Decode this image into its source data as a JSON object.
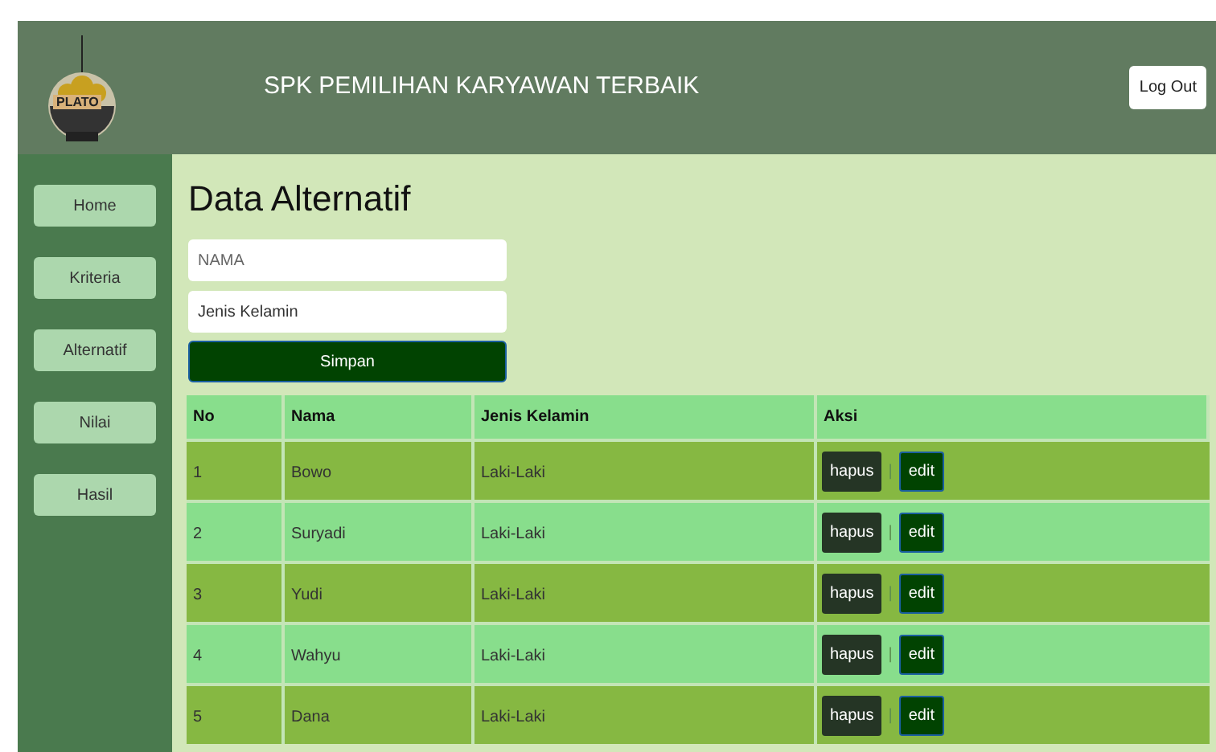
{
  "header": {
    "logo_text": "PLATO",
    "title": "SPK PEMILIHAN KARYAWAN TERBAIK",
    "logout": "Log Out"
  },
  "sidebar": {
    "items": [
      {
        "label": "Home"
      },
      {
        "label": "Kriteria"
      },
      {
        "label": "Alternatif"
      },
      {
        "label": "Nilai"
      },
      {
        "label": "Hasil"
      }
    ]
  },
  "page_title": "Data Alternatif",
  "form": {
    "name_field": {
      "placeholder": "NAMA"
    },
    "gender_field": {
      "placeholder": "Jenis Kelamin"
    },
    "submit": "Simpan"
  },
  "table": {
    "columns": [
      "No",
      "Nama",
      "Jenis Kelamin",
      "Aksi"
    ],
    "rows": [
      {
        "no": "1",
        "nama": "Bowo",
        "jenis_kelamin": "Laki-Laki",
        "delete": "hapus",
        "divider": "|",
        "edit": "edit"
      },
      {
        "no": "2",
        "nama": "Suryadi",
        "jenis_kelamin": "Laki-Laki",
        "delete": "hapus",
        "divider": "|",
        "edit": "edit"
      },
      {
        "no": "3",
        "nama": "Yudi",
        "jenis_kelamin": "Laki-Laki",
        "delete": "hapus",
        "divider": "|",
        "edit": "edit"
      },
      {
        "no": "4",
        "nama": "Wahyu",
        "jenis_kelamin": "Laki-Laki",
        "delete": "hapus",
        "divider": "|",
        "edit": "edit"
      },
      {
        "no": "5",
        "nama": "Dana",
        "jenis_kelamin": "Laki-Laki",
        "delete": "hapus",
        "divider": "|",
        "edit": "edit"
      }
    ]
  }
}
